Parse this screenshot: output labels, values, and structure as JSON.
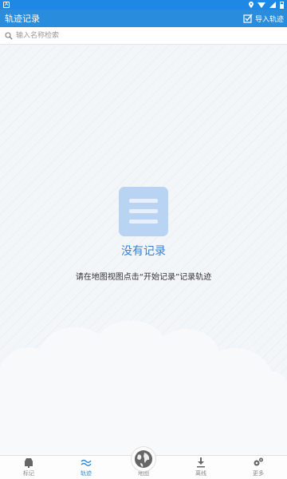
{
  "status_bar": {
    "app_icon": "A",
    "icons": [
      "location-icon",
      "wifi-icon",
      "signal-icon",
      "battery-icon"
    ]
  },
  "app_bar": {
    "title": "轨迹记录",
    "import_label": "导入轨迹"
  },
  "search": {
    "placeholder": "输入名称检索",
    "value": ""
  },
  "empty_state": {
    "title": "没有记录",
    "hint": "请在地图视图点击“开始记录”记录轨迹"
  },
  "tabs": [
    {
      "label": "标记",
      "icon": "marker-icon",
      "active": false
    },
    {
      "label": "轨迹",
      "icon": "track-icon",
      "active": true
    },
    {
      "label": "地图",
      "icon": "globe-icon",
      "active": false
    },
    {
      "label": "离线",
      "icon": "download-icon",
      "active": false
    },
    {
      "label": "更多",
      "icon": "gears-icon",
      "active": false
    }
  ],
  "colors": {
    "primary": "#2a8cdc",
    "status_bar": "#1f88e5",
    "empty_icon": "#b9d3f3",
    "empty_title": "#3b7fd4"
  }
}
